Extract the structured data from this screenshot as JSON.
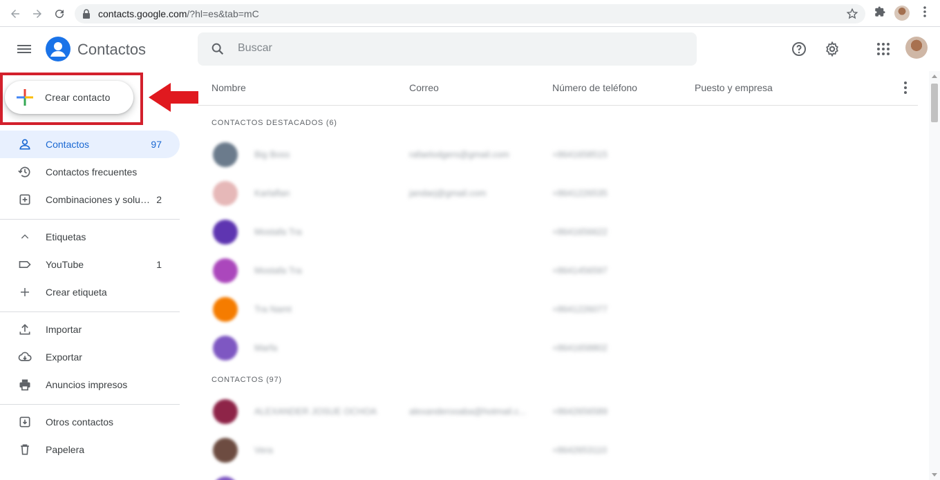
{
  "browser": {
    "url_host": "contacts.google.com",
    "url_path": "/?hl=es&tab=mC"
  },
  "app": {
    "title": "Contactos",
    "search_placeholder": "Buscar"
  },
  "sidebar": {
    "create_label": "Crear contacto",
    "items": [
      {
        "label": "Contactos",
        "count": "97",
        "icon": "person-icon"
      },
      {
        "label": "Contactos frecuentes",
        "count": "",
        "icon": "history-icon"
      },
      {
        "label": "Combinaciones y solu…",
        "count": "2",
        "icon": "merge-icon"
      },
      {
        "label": "Etiquetas",
        "count": "",
        "icon": "chevron-up-icon"
      },
      {
        "label": "YouTube",
        "count": "1",
        "icon": "label-icon"
      },
      {
        "label": "Crear etiqueta",
        "count": "",
        "icon": "add-icon"
      },
      {
        "label": "Importar",
        "count": "",
        "icon": "upload-icon"
      },
      {
        "label": "Exportar",
        "count": "",
        "icon": "cloud-download-icon"
      },
      {
        "label": "Anuncios impresos",
        "count": "",
        "icon": "print-icon"
      },
      {
        "label": "Otros contactos",
        "count": "",
        "icon": "archive-icon"
      },
      {
        "label": "Papelera",
        "count": "",
        "icon": "trash-icon"
      }
    ]
  },
  "table": {
    "columns": [
      "Nombre",
      "Correo",
      "Número de teléfono",
      "Puesto y empresa"
    ],
    "starred_title": "CONTACTOS DESTACADOS (6)",
    "contacts_title": "CONTACTOS (97)",
    "starred": [
      {
        "name": "Big Boss",
        "email": "rafaelodgers@gmail.com",
        "phone": "+8641658515",
        "color": "#6b7b8c"
      },
      {
        "name": "Karlaflan",
        "email": "jandarj@gmail.com",
        "phone": "+8641226535",
        "color": "#d98a8a"
      },
      {
        "name": "Mostafa Tra",
        "email": "",
        "phone": "+8641656622",
        "color": "#5e35b1"
      },
      {
        "name": "Mostafa Tra",
        "email": "",
        "phone": "+8641456597",
        "color": "#ab47bc"
      },
      {
        "name": "Tra Namt",
        "email": "",
        "phone": "+8641226077",
        "color": "#f57c00"
      },
      {
        "name": "Marfa",
        "email": "",
        "phone": "+8641658802",
        "color": "#7e57c2"
      }
    ],
    "contacts": [
      {
        "name": "ALEXANDER JOSUE OCHOA",
        "email": "alexanderooaba@hotmail.c...",
        "phone": "+8642656589",
        "color": "#8e2448"
      },
      {
        "name": "Vera",
        "email": "",
        "phone": "+8642653110",
        "color": "#6d4c41"
      }
    ]
  }
}
